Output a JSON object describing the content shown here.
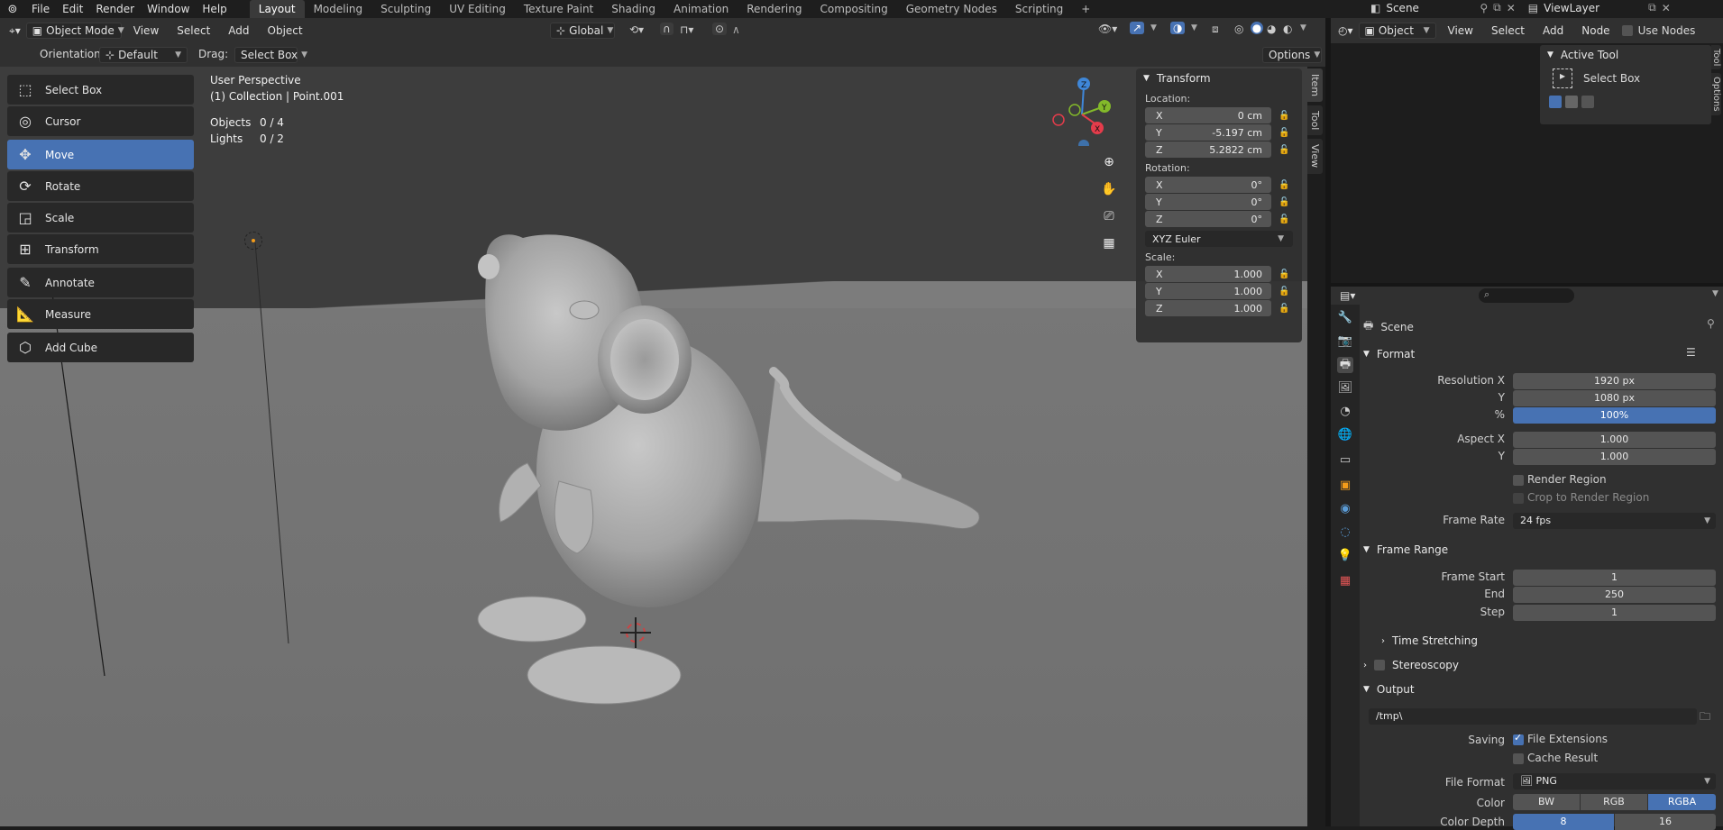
{
  "app_menu": [
    "File",
    "Edit",
    "Render",
    "Window",
    "Help"
  ],
  "workspaces": [
    "Layout",
    "Modeling",
    "Sculpting",
    "UV Editing",
    "Texture Paint",
    "Shading",
    "Animation",
    "Rendering",
    "Compositing",
    "Geometry Nodes",
    "Scripting"
  ],
  "add_workspace": "+",
  "scene": {
    "name": "Scene",
    "view_layer": "ViewLayer"
  },
  "viewport_header": {
    "mode": "Object Mode",
    "menus": [
      "View",
      "Select",
      "Add",
      "Object"
    ],
    "transform_orientation": "Global"
  },
  "tool_settings": {
    "orientation_label": "Orientation:",
    "orientation_value": "Default",
    "drag_label": "Drag:",
    "drag_value": "Select Box",
    "options": "Options"
  },
  "toolbar": [
    {
      "label": "Select Box",
      "icon": "select-box-icon",
      "active": false
    },
    {
      "label": "Cursor",
      "icon": "cursor-icon",
      "active": false
    },
    {
      "label": "Move",
      "icon": "move-icon",
      "active": true
    },
    {
      "label": "Rotate",
      "icon": "rotate-icon",
      "active": false
    },
    {
      "label": "Scale",
      "icon": "scale-icon",
      "active": false
    },
    {
      "label": "Transform",
      "icon": "transform-icon",
      "active": false
    },
    {
      "label": "Annotate",
      "icon": "annotate-icon",
      "active": false
    },
    {
      "label": "Measure",
      "icon": "measure-icon",
      "active": false
    },
    {
      "label": "Add Cube",
      "icon": "add-cube-icon",
      "active": false
    }
  ],
  "overlay": {
    "perspective": "User Perspective",
    "collection": "(1) Collection | Point.001",
    "objects_label": "Objects",
    "objects_value": "0 / 4",
    "lights_label": "Lights",
    "lights_value": "0 / 2"
  },
  "gizmo": {
    "x": "X",
    "y": "Y",
    "z": "Z"
  },
  "transform_panel": {
    "title": "Transform",
    "location_label": "Location:",
    "location": [
      {
        "axis": "X",
        "value": "0 cm"
      },
      {
        "axis": "Y",
        "value": "-5.197 cm"
      },
      {
        "axis": "Z",
        "value": "5.2822 cm"
      }
    ],
    "rotation_label": "Rotation:",
    "rotation": [
      {
        "axis": "X",
        "value": "0°"
      },
      {
        "axis": "Y",
        "value": "0°"
      },
      {
        "axis": "Z",
        "value": "0°"
      }
    ],
    "rotation_mode": "XYZ Euler",
    "scale_label": "Scale:",
    "scale": [
      {
        "axis": "X",
        "value": "1.000"
      },
      {
        "axis": "Y",
        "value": "1.000"
      },
      {
        "axis": "Z",
        "value": "1.000"
      }
    ]
  },
  "sidebar_tabs": [
    "Item",
    "Tool",
    "View"
  ],
  "node_editor": {
    "object_dropdown": "Object",
    "menus": [
      "View",
      "Select",
      "Add",
      "Node"
    ],
    "use_nodes": "Use Nodes",
    "active_tool_title": "Active Tool",
    "active_tool_name": "Select Box",
    "side_tabs": [
      "Tool",
      "Options"
    ]
  },
  "properties": {
    "context": "Scene",
    "format": {
      "title": "Format",
      "resolution_x_label": "Resolution X",
      "resolution_x": "1920 px",
      "y_label": "Y",
      "resolution_y": "1080 px",
      "percent_label": "%",
      "percent": "100%",
      "aspect_x_label": "Aspect X",
      "aspect_x": "1.000",
      "aspect_y_label": "Y",
      "aspect_y": "1.000",
      "render_region": "Render Region",
      "crop_region": "Crop to Render Region",
      "frame_rate_label": "Frame Rate",
      "frame_rate": "24 fps"
    },
    "frame_range": {
      "title": "Frame Range",
      "start_label": "Frame Start",
      "start": "1",
      "end_label": "End",
      "end": "250",
      "step_label": "Step",
      "step": "1",
      "time_stretching": "Time Stretching"
    },
    "stereoscopy": "Stereoscopy",
    "output": {
      "title": "Output",
      "path": "/tmp\\",
      "saving_label": "Saving",
      "file_extensions": "File Extensions",
      "cache_result": "Cache Result",
      "file_format_label": "File Format",
      "file_format": "PNG",
      "color_label": "Color",
      "color_options": [
        "BW",
        "RGB",
        "RGBA"
      ],
      "color_selected": "RGBA",
      "color_depth_label": "Color Depth",
      "depth_options": [
        "8",
        "16"
      ],
      "depth_selected": "8"
    }
  },
  "colors": {
    "accent": "#4772b3",
    "axis_x": "#e53c4b",
    "axis_y": "#83b92a",
    "axis_z": "#3f87d8",
    "light_origin": "#f39b1a"
  }
}
